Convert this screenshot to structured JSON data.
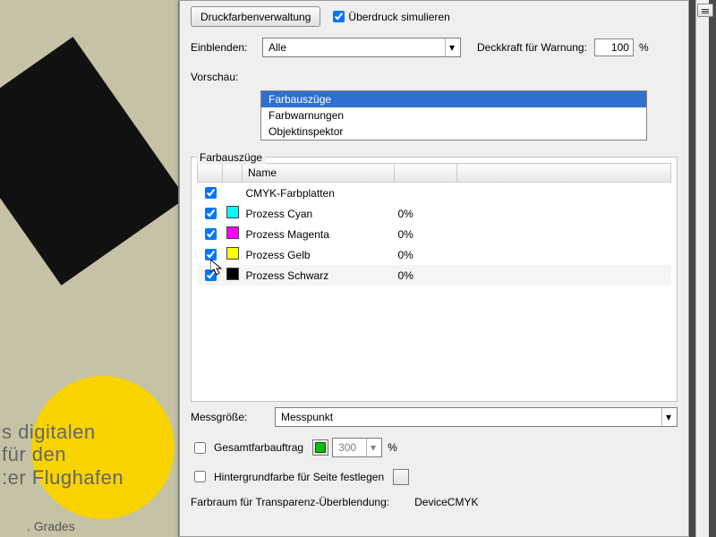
{
  "toolbar": {
    "ink_mgmt_btn": "Druckfarbenverwaltung",
    "overprint_label": "Überdruck simulieren",
    "overprint_checked": true
  },
  "show": {
    "label": "Einblenden:",
    "value": "Alle",
    "opacity_label": "Deckkraft für Warnung:",
    "opacity_value": "100",
    "opacity_unit": "%"
  },
  "preview": {
    "label": "Vorschau:",
    "items": [
      "Farbauszüge",
      "Farbwarnungen",
      "Objektinspektor"
    ],
    "selected": 0
  },
  "separations": {
    "title": "Farbauszüge",
    "header_name": "Name",
    "rows": [
      {
        "checked": true,
        "swatch": null,
        "name": "CMYK-Farbplatten",
        "pct": ""
      },
      {
        "checked": true,
        "swatch": "#00ffff",
        "name": "Prozess Cyan",
        "pct": "0%"
      },
      {
        "checked": true,
        "swatch": "#ff00ff",
        "name": "Prozess Magenta",
        "pct": "0%"
      },
      {
        "checked": true,
        "swatch": "#ffff00",
        "name": "Prozess Gelb",
        "pct": "0%"
      },
      {
        "checked": true,
        "swatch": "#000000",
        "name": "Prozess Schwarz",
        "pct": "0%"
      }
    ]
  },
  "measure": {
    "label": "Messgröße:",
    "value": "Messpunkt"
  },
  "tac": {
    "label": "Gesamtfarbauftrag",
    "value": "300",
    "unit": "%"
  },
  "bg": {
    "label": "Hintergrundfarbe für Seite festlegen"
  },
  "blend": {
    "label": "Farbraum für Transparenz-Überblendung:",
    "value": "DeviceCMYK"
  },
  "doc_text": {
    "headline": "s",
    "lines": "s digitalen\nfür den\n:er Flughafen",
    "grades": ". Grades"
  }
}
